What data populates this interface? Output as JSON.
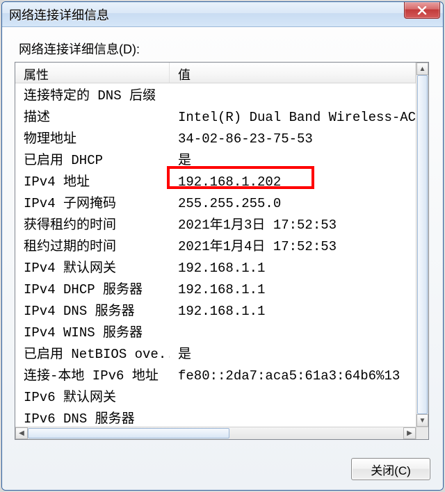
{
  "window": {
    "title": "网络连接详细信息"
  },
  "group_label": "网络连接详细信息(D):",
  "columns": {
    "property": "属性",
    "value": "值"
  },
  "rows": [
    {
      "prop": "连接特定的 DNS 后缀",
      "val": ""
    },
    {
      "prop": "描述",
      "val": "Intel(R) Dual Band Wireless-AC"
    },
    {
      "prop": "物理地址",
      "val": "34-02-86-23-75-53"
    },
    {
      "prop": "已启用 DHCP",
      "val": "是"
    },
    {
      "prop": "IPv4 地址",
      "val": "192.168.1.202"
    },
    {
      "prop": "IPv4 子网掩码",
      "val": "255.255.255.0"
    },
    {
      "prop": "获得租约的时间",
      "val": "2021年1月3日 17:52:53"
    },
    {
      "prop": "租约过期的时间",
      "val": "2021年1月4日 17:52:53"
    },
    {
      "prop": "IPv4 默认网关",
      "val": "192.168.1.1"
    },
    {
      "prop": "IPv4 DHCP 服务器",
      "val": "192.168.1.1"
    },
    {
      "prop": "IPv4 DNS 服务器",
      "val": "192.168.1.1"
    },
    {
      "prop": "IPv4 WINS 服务器",
      "val": ""
    },
    {
      "prop": "已启用 NetBIOS ove...",
      "val": "是"
    },
    {
      "prop": "连接-本地 IPv6 地址",
      "val": "fe80::2da7:aca5:61a3:64b6%13"
    },
    {
      "prop": "IPv6 默认网关",
      "val": ""
    },
    {
      "prop": "IPv6 DNS 服务器",
      "val": ""
    }
  ],
  "highlight_row_index": 4,
  "buttons": {
    "close": "关闭(C)"
  }
}
